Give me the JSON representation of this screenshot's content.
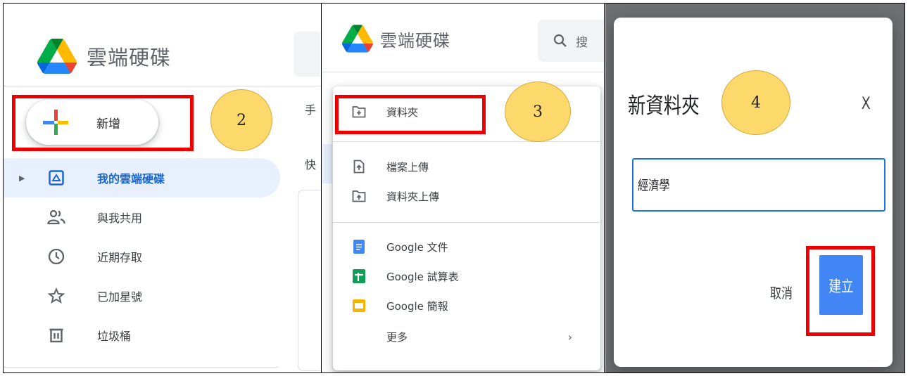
{
  "app": {
    "title": "雲端硬碟"
  },
  "step_markers": [
    "2",
    "3",
    "4"
  ],
  "panel1": {
    "new_button": "新增",
    "nav": [
      {
        "label": "我的雲端硬碟",
        "icon": "my-drive-icon",
        "active": true
      },
      {
        "label": "與我共用",
        "icon": "shared-users-icon",
        "active": false
      },
      {
        "label": "近期存取",
        "icon": "clock-icon",
        "active": false
      },
      {
        "label": "已加星號",
        "icon": "star-icon",
        "active": false
      },
      {
        "label": "垃圾桶",
        "icon": "trash-icon",
        "active": false
      }
    ],
    "peek_chars": [
      "手",
      "快"
    ]
  },
  "panel2": {
    "search_placeholder": "搜",
    "menu": {
      "folder": "資料夾",
      "file_upload": "檔案上傳",
      "folder_upload": "資料夾上傳",
      "docs": "Google 文件",
      "sheets": "Google 試算表",
      "slides": "Google 簡報",
      "more": "更多",
      "more_arrow": "›"
    }
  },
  "panel3": {
    "dialog_title": "新資料夾",
    "close_label": "X",
    "folder_name_value": "經濟學",
    "cancel_label": "取消",
    "create_label": "建立"
  },
  "colors": {
    "highlight_red": "#ee0000",
    "step_circle": "#fdd86b",
    "accent_blue": "#1a73e8",
    "active_nav_bg": "#e8f0fe",
    "create_button": "#4285f4"
  }
}
